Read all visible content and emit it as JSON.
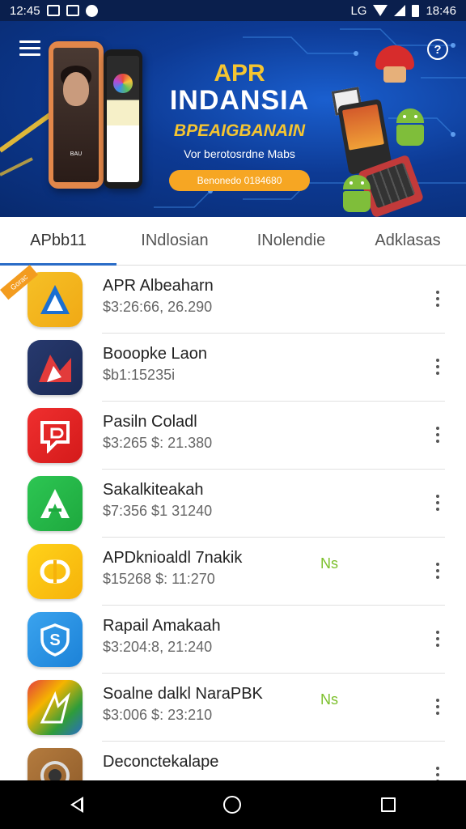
{
  "status_bar": {
    "time_left": "12:45",
    "time_right": "18:46",
    "carrier_right": "LG"
  },
  "banner": {
    "title_line1": "APR",
    "title_line2": "INDANSIA",
    "subtitle": "BPEAIGBANAIN",
    "tagline": "Vor berotosrdne Mabs",
    "cta_label": "Benonedo 0184680",
    "phone_screen_text": "BAU"
  },
  "tabs": [
    {
      "label": "APbb11",
      "active": true
    },
    {
      "label": "INdlosian",
      "active": false
    },
    {
      "label": "INolendie",
      "active": false
    },
    {
      "label": "Adklasas",
      "active": false
    }
  ],
  "apps": [
    {
      "name": "APR Albeaharn",
      "meta": "$3:26:66, 26.290",
      "tag": "",
      "ribbon": "Gorac",
      "icon": "a-triangle-icon",
      "color_from": "#f6c026",
      "color_to": "#f0a915"
    },
    {
      "name": "Booopke Laon",
      "meta": "$b1:15235i",
      "tag": "",
      "ribbon": "",
      "icon": "flag-arrow-icon",
      "color_from": "#27396e",
      "color_to": "#1b2a55"
    },
    {
      "name": "Pasiln Coladl",
      "meta": "$3:265 $: 21.380",
      "tag": "",
      "ribbon": "",
      "icon": "chat-p-icon",
      "color_from": "#ef2f2f",
      "color_to": "#d41a1a"
    },
    {
      "name": "Sakalkiteakah",
      "meta": "$7:356 $1 31240",
      "tag": "",
      "ribbon": "",
      "icon": "a-leaf-icon",
      "color_from": "#2dc653",
      "color_to": "#1ea83e"
    },
    {
      "name": "APDknioaldl 7nakik",
      "meta": "$15268 $: 11:270",
      "tag": "Ns",
      "ribbon": "",
      "icon": "ring-icon",
      "color_from": "#ffd21a",
      "color_to": "#f6b20a"
    },
    {
      "name": "Rapail Amakaah",
      "meta": "$3:204:8, 21:240",
      "tag": "",
      "ribbon": "",
      "icon": "shield-s-icon",
      "color_from": "#3aa3ee",
      "color_to": "#1c82d8"
    },
    {
      "name": "Soalne dalkl NaraPBK",
      "meta": "$3:006 $: 23:210",
      "tag": "Ns",
      "ribbon": "",
      "icon": "colorful-arrow-icon",
      "color_from": "#e33d3d",
      "color_to": "#2f9c3a"
    },
    {
      "name": "Deconctekalape",
      "meta": "",
      "tag": "",
      "ribbon": "",
      "icon": "camera-lens-icon",
      "color_from": "#b47b3e",
      "color_to": "#8f5c2a"
    }
  ]
}
